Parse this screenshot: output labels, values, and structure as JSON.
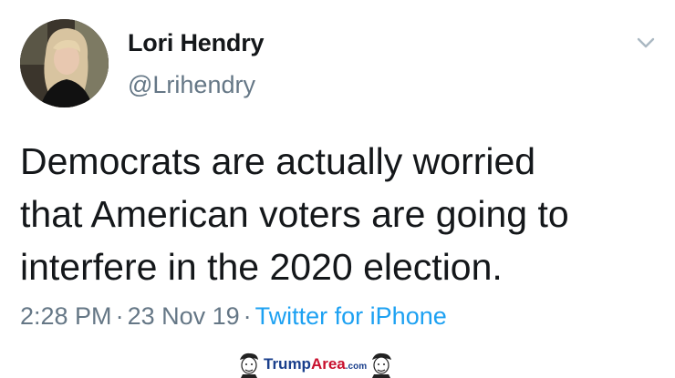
{
  "tweet": {
    "author_name": "Lori Hendry",
    "author_handle": "@Lrihendry",
    "text_lines": [
      "Democrats are actually worried",
      "that American voters are going to",
      "interfere in the 2020 election."
    ],
    "time": "2:28 PM",
    "date": "23 Nov 19",
    "separator": "·",
    "source": "Twitter for iPhone"
  },
  "icons": {
    "more_menu": "chevron-down-icon",
    "avatar": "profile-photo"
  },
  "watermark": {
    "brand_part1": "Trump",
    "brand_part2": "Area",
    "brand_suffix": ".com"
  },
  "colors": {
    "text": "#14171a",
    "secondary": "#657786",
    "link": "#1da1f2",
    "watermark_blue": "#1a3f8c",
    "watermark_red": "#c8102e"
  }
}
